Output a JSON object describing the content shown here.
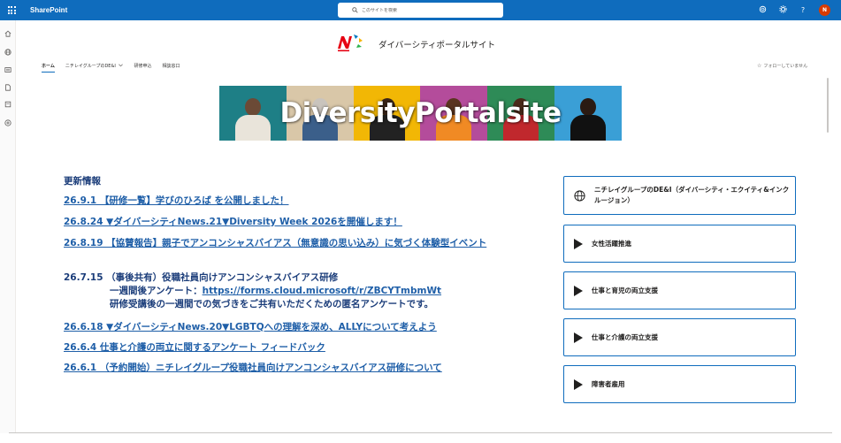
{
  "suite_bar": {
    "app_name": "SharePoint",
    "search_placeholder": "このサイトを検索",
    "avatar_initial": "N",
    "color": "#0f6cbd"
  },
  "left_rail": {
    "icons": [
      "home-icon",
      "globe-icon",
      "news-icon",
      "file-icon",
      "pages-icon",
      "add-icon"
    ]
  },
  "site": {
    "title": "ダイバーシティポータルサイト"
  },
  "nav": {
    "items": [
      "ホーム",
      "ニチレイグループのDE&I",
      "研修申込",
      "相談窓口"
    ],
    "active_index": 0,
    "follow_label": "フォローしていません"
  },
  "banner": {
    "text": "DiversityPortalsite",
    "panel_colors": [
      "#1e7f86",
      "#d9c7a8",
      "#f2b705",
      "#b44c9b",
      "#2e8b57",
      "#3a9fd6"
    ]
  },
  "news": {
    "heading": "更新情報",
    "items": [
      {
        "text": "26.9.1 【研修一覧】学びのひろば を公開しました！"
      },
      {
        "text": "26.8.24 ▼ダイバーシティNews.21▼Diversity Week 2026を開催します！"
      },
      {
        "text": "26.8.19 【協賛報告】親子でアンコンシャスバイアス（無意識の思い込み）に気づく体験型イベント"
      },
      {
        "line1": "26.7.15 （事後共有）役職社員向けアンコンシャスバイアス研修",
        "line2_prefix": "一週間後アンケート：",
        "line2_link": "https://forms.cloud.microsoft/r/ZBCYTmbmWt",
        "line3": "研修受講後の一週間での気づきをご共有いただくための匿名アンケートです。"
      },
      {
        "text": "26.6.18 ▼ダイバーシティNews.20▼LGBTQへの理解を深め、ALLYについて考えよう"
      },
      {
        "text": "26.6.4 仕事と介護の両立に関するアンケート フィードバック"
      },
      {
        "text": "26.6.1 （予約開始）ニチレイグループ役職社員向けアンコンシャスバイアス研修について"
      }
    ]
  },
  "quick_links": [
    {
      "label": "ニチレイグループのDE&I（ダイバーシティ・エクイティ&インクルージョン）",
      "icon": "globe-icon"
    },
    {
      "label": "女性活躍推進",
      "icon": "play-icon"
    },
    {
      "label": "仕事と育児の両立支援",
      "icon": "play-icon"
    },
    {
      "label": "仕事と介護の両立支援",
      "icon": "play-icon"
    },
    {
      "label": "障害者雇用",
      "icon": "play-icon"
    }
  ]
}
